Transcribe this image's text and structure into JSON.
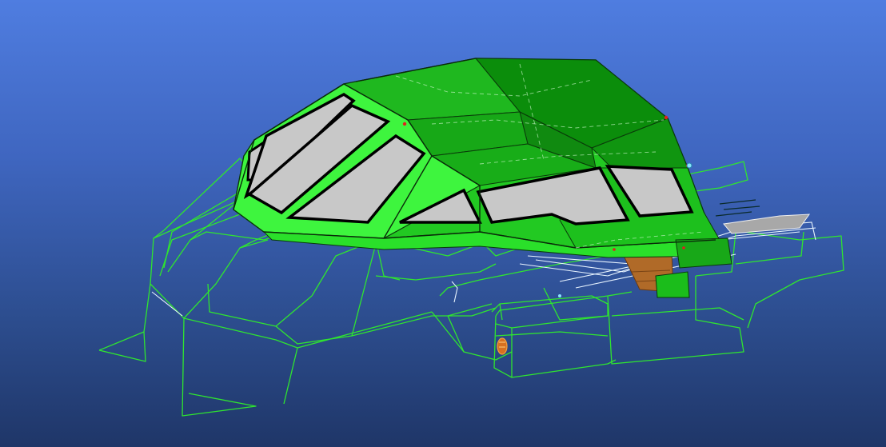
{
  "viewport": {
    "background_top": "#4f7de0",
    "background_bottom": "#1f3668"
  },
  "model": {
    "canopy_color": "#1fc41f",
    "canopy_dark_color": "#0a8a0a",
    "frame_color": "#3df23d",
    "window_color": "#c8c8c8",
    "wireframe_color": "#2fe52f",
    "accent_color": "#c87a30"
  }
}
